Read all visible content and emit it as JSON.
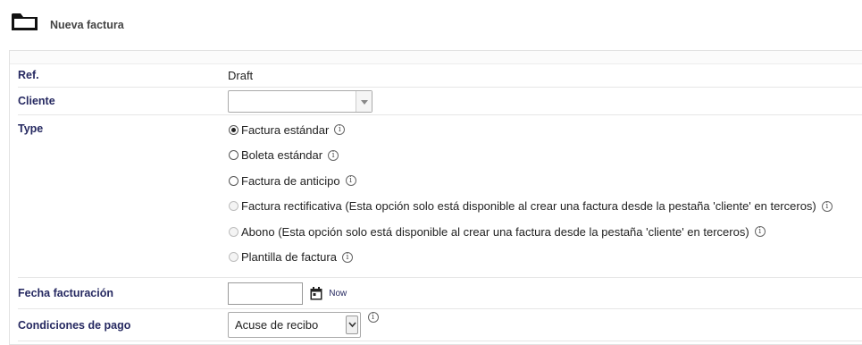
{
  "header": {
    "title": "Nueva factura",
    "icon": "folder-icon"
  },
  "fields": {
    "ref": {
      "label": "Ref.",
      "value": "Draft"
    },
    "cliente": {
      "label": "Cliente",
      "value": ""
    },
    "type": {
      "label": "Type",
      "options": [
        {
          "label": "Factura estándar",
          "selected": true,
          "disabled": false
        },
        {
          "label": "Boleta estándar",
          "selected": false,
          "disabled": false
        },
        {
          "label": "Factura de anticipo",
          "selected": false,
          "disabled": false
        },
        {
          "label": "Factura rectificativa (Esta opción solo está disponible al crear una factura desde la pestaña 'cliente' en terceros)",
          "selected": false,
          "disabled": true
        },
        {
          "label": "Abono (Esta opción solo está disponible al crear una factura desde la pestaña 'cliente' en terceros)",
          "selected": false,
          "disabled": true
        },
        {
          "label": "Plantilla de factura",
          "selected": false,
          "disabled": true
        }
      ]
    },
    "fecha": {
      "label": "Fecha facturación",
      "value": "",
      "now_label": "Now"
    },
    "condiciones": {
      "label": "Condiciones de pago",
      "selected": "Acuse de recibo"
    }
  },
  "info_icon": "i"
}
